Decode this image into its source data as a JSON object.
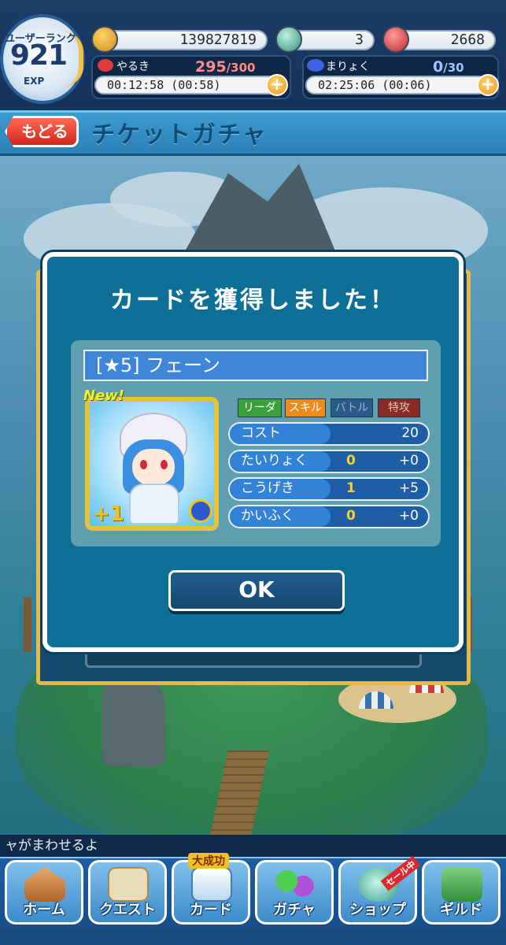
{
  "hud": {
    "rank_label": "ユーザーランク",
    "rank_value": "921",
    "exp_label": "EXP",
    "coins": "139827819",
    "gems": "3",
    "magic_stones": "2668",
    "stamina": {
      "label": "やるき",
      "current": "295",
      "max": "/300",
      "timer": "00:12:58 (00:58)"
    },
    "mana": {
      "label": "まりょく",
      "current": "0",
      "max": "/30",
      "timer": "02:25:06 (00:06)"
    },
    "plus_symbol": "+"
  },
  "subheader": {
    "back_label": "もどる",
    "title": "チケットガチャ"
  },
  "modal": {
    "title": "カードを獲得しました！",
    "card_name": "[★5] フェーン",
    "new_badge": "New!",
    "plus_level": "+1",
    "tags": [
      "リーダー",
      "スキル",
      "バトル",
      "特攻"
    ],
    "stats": [
      {
        "name": "コスト",
        "base": "",
        "bonus": "20"
      },
      {
        "name": "たいりょく",
        "base": "0",
        "bonus": "+0"
      },
      {
        "name": "こうげき",
        "base": "1",
        "bonus": "+5"
      },
      {
        "name": "かいふく",
        "base": "0",
        "bonus": "+0"
      }
    ],
    "ok_label": "OK"
  },
  "ticker": "ャがまわせるよ",
  "nav": [
    {
      "label": "ホーム",
      "icon": "house-icon",
      "badge": ""
    },
    {
      "label": "クエスト",
      "icon": "map-icon",
      "badge": ""
    },
    {
      "label": "カード",
      "icon": "card-icon",
      "badge": "大成功"
    },
    {
      "label": "ガチャ",
      "icon": "puyo-icon",
      "badge": ""
    },
    {
      "label": "ショップ",
      "icon": "gem-icon",
      "badge": "セール中"
    },
    {
      "label": "ギルド",
      "icon": "castle-icon",
      "badge": ""
    }
  ],
  "colors": {
    "accent_blue": "#0e7096",
    "frame_gold": "#e6b94a",
    "back_red": "#d2261b",
    "tag_leader": "#3aa03a",
    "tag_skill": "#f08a1a",
    "tag_battle": "#2a5a8a",
    "tag_special": "#8a2a24"
  }
}
